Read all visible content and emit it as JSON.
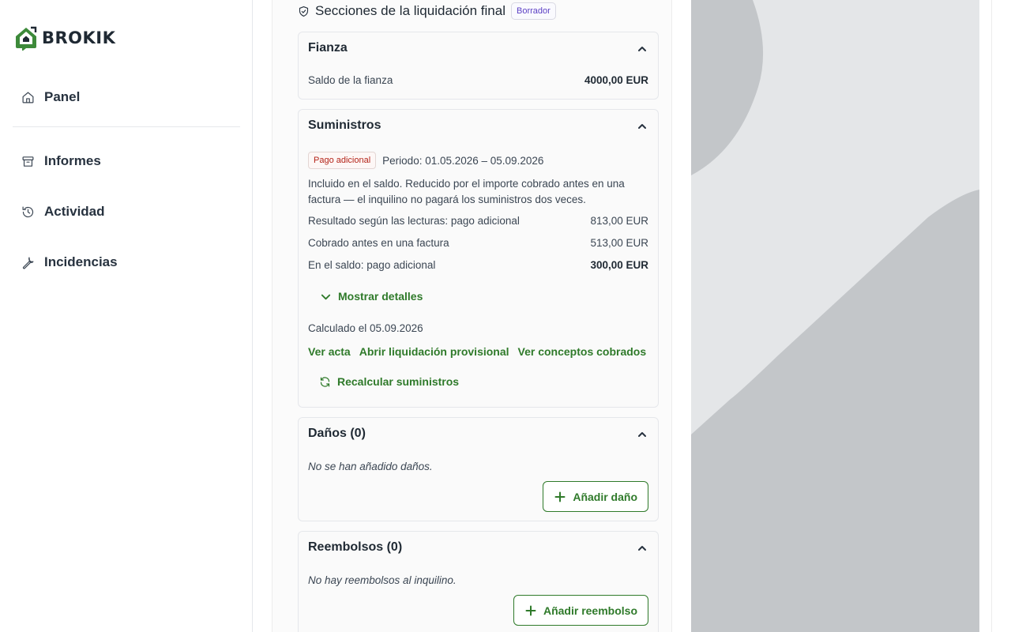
{
  "brand": {
    "name": "BROKIK",
    "colors": {
      "accent": "#2f7a2a",
      "logo_green": "#3d8a3a"
    }
  },
  "sidebar": {
    "items": [
      {
        "label": "Panel",
        "icon": "home-icon"
      },
      {
        "label": "Informes",
        "icon": "archive-icon"
      },
      {
        "label": "Actividad",
        "icon": "history-icon"
      },
      {
        "label": "Incidencias",
        "icon": "wrench-icon"
      }
    ]
  },
  "main": {
    "section_title": "Secciones de la liquidación final",
    "status_badge": "Borrador",
    "fianza": {
      "title": "Fianza",
      "balance_label": "Saldo de la fianza",
      "balance_value": "4000,00 EUR"
    },
    "suministros": {
      "title": "Suministros",
      "tag": "Pago adicional",
      "period": "Periodo: 01.05.2026 – 05.09.2026",
      "description": "Incluido en el saldo. Reducido por el importe cobrado antes en una factura — el inquilino no pagará los suministros dos veces.",
      "rows": [
        {
          "label": "Resultado según las lecturas: pago adicional",
          "value": "813,00 EUR"
        },
        {
          "label": "Cobrado antes en una factura",
          "value": "513,00 EUR"
        },
        {
          "label": "En el saldo: pago adicional",
          "value": "300,00 EUR"
        }
      ],
      "show_details": "Mostrar detalles",
      "calculated": "Calculado el 05.09.2026",
      "links": [
        "Ver acta",
        "Abrir liquidación provisional",
        "Ver conceptos cobrados"
      ],
      "recalc": "Recalcular suministros"
    },
    "danos": {
      "title": "Daños (0)",
      "empty": "No se han añadido daños.",
      "add_button": "Añadir daño"
    },
    "reembolsos": {
      "title": "Reembolsos (0)",
      "empty": "No hay reembolsos al inquilino.",
      "add_button": "Añadir reembolso"
    }
  }
}
